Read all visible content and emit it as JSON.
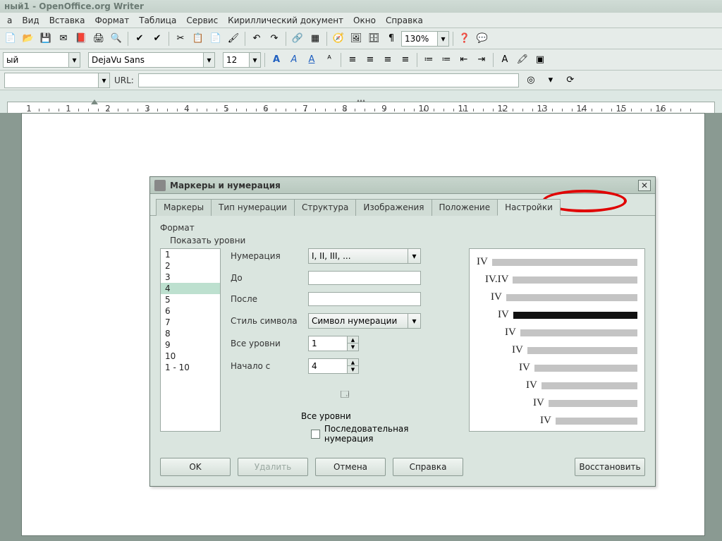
{
  "title": "ный1 - OpenOffice.org Writer",
  "menu": {
    "items": [
      "а",
      "Вид",
      "Вставка",
      "Формат",
      "Таблица",
      "Сервис",
      "Кириллический документ",
      "Окно",
      "Справка"
    ]
  },
  "toolbar2": {
    "style": "ый",
    "font": "DejaVu Sans",
    "size": "12",
    "zoom": "130%"
  },
  "urlbar": {
    "label": "URL:",
    "value": ""
  },
  "ruler_nums": [
    "1",
    "1",
    "2",
    "3",
    "4",
    "5",
    "6",
    "7",
    "8",
    "9",
    "10",
    "11",
    "12",
    "13",
    "14",
    "15",
    "16"
  ],
  "dialog": {
    "title": "Маркеры и нумерация",
    "tabs": [
      "Маркеры",
      "Тип нумерации",
      "Структура",
      "Изображения",
      "Положение",
      "Настройки"
    ],
    "active_tab": 5,
    "format_label": "Формат",
    "show_levels_label": "Показать уровни",
    "levels": [
      "1",
      "2",
      "3",
      "4",
      "5",
      "6",
      "7",
      "8",
      "9",
      "10",
      "1 - 10"
    ],
    "selected_level": "4",
    "fields": {
      "numbering_label": "Нумерация",
      "numbering_value": "I, II, III, ...",
      "before_label": "До",
      "before_value": "",
      "after_label": "После",
      "after_value": "",
      "charstyle_label": "Стиль символа",
      "charstyle_value": "Символ нумерации",
      "alllevels_label": "Все уровни",
      "alllevels_value": "1",
      "start_label": "Начало с",
      "start_value": "4"
    },
    "all_levels_section": "Все уровни",
    "consecutive_label": "Последовательная нумерация",
    "preview": [
      "IV",
      "IV.IV",
      "IV",
      "IV",
      "IV",
      "IV",
      "IV",
      "IV",
      "IV",
      "IV"
    ],
    "buttons": {
      "ok": "OK",
      "delete": "Удалить",
      "cancel": "Отмена",
      "help": "Справка",
      "reset": "Восстановить"
    }
  }
}
